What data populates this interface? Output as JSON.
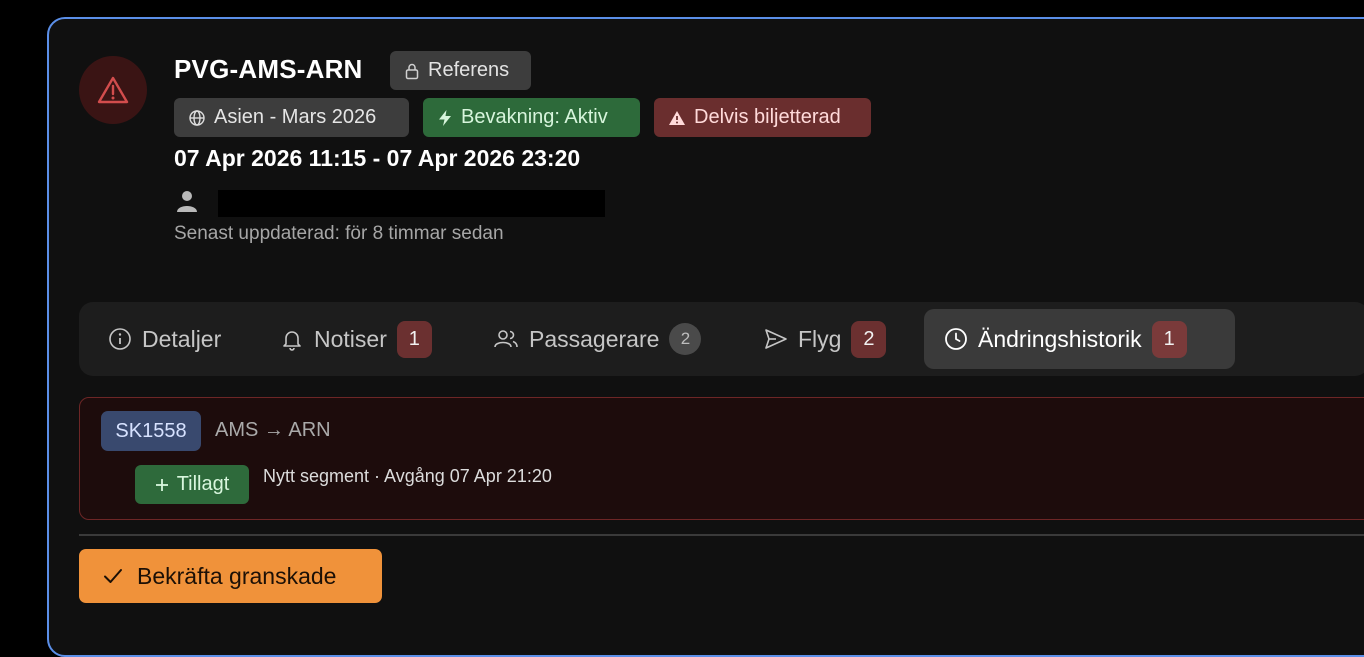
{
  "header": {
    "title": "PVG-AMS-ARN",
    "reference_label": "Referens",
    "chips": {
      "region": "Asien - Mars 2026",
      "watch": "Bevakning: Aktiv",
      "ticket_status": "Delvis biljetterad"
    },
    "dates": "07 Apr 2026 11:15 - 07 Apr 2026 23:20",
    "updated": "Senast uppdaterad: för 8 timmar sedan"
  },
  "tabs": [
    {
      "label": "Detaljer",
      "icon": "info-icon",
      "count": null
    },
    {
      "label": "Notiser",
      "icon": "bell-icon",
      "count": "1"
    },
    {
      "label": "Passagerare",
      "icon": "users-icon",
      "count": "2"
    },
    {
      "label": "Flyg",
      "icon": "send-icon",
      "count": "2"
    },
    {
      "label": "Ändringshistorik",
      "icon": "clock-icon",
      "count": "1",
      "active": true
    }
  ],
  "change": {
    "flight": "SK1558",
    "route": "AMS → ARN",
    "status": "Tillagt",
    "description": "Nytt segment · Avgång 07 Apr 21:20"
  },
  "confirm_button": "Bekräfta granskade",
  "colors": {
    "panel_border": "#5b8fe8",
    "accent_orange": "#f0923a",
    "danger": "#6b3030",
    "success": "#2d6a3a"
  }
}
